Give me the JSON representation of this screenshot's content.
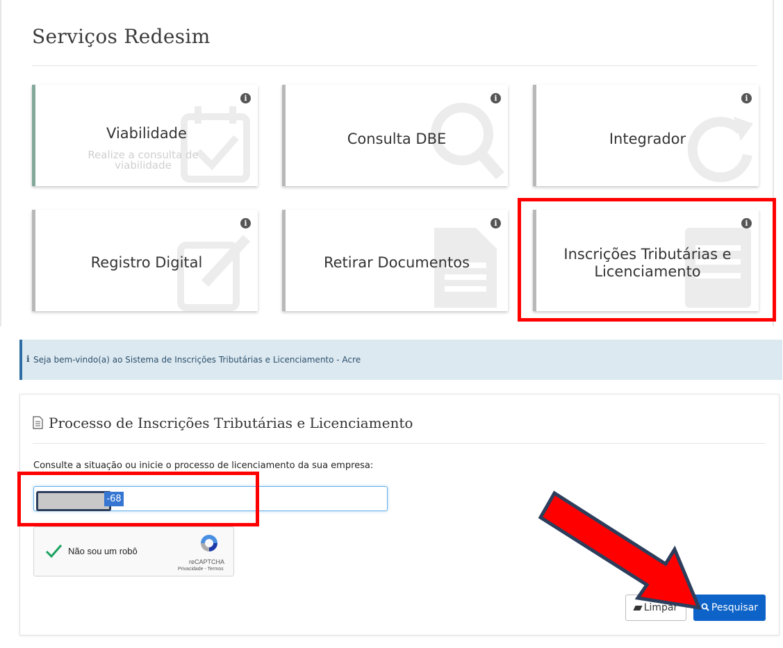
{
  "services": {
    "title": "Serviços Redesim",
    "cards": [
      {
        "label": "Viabilidade",
        "subtitle": "Realize a consulta de viabilidade",
        "icon": "calendar-check-icon"
      },
      {
        "label": "Consulta DBE",
        "icon": "search-icon"
      },
      {
        "label": "Integrador",
        "icon": "refresh-icon"
      },
      {
        "label": "Registro Digital",
        "icon": "edit-icon"
      },
      {
        "label": "Retirar Documentos",
        "icon": "document-icon"
      },
      {
        "label": "Inscrições Tributárias e Licenciamento",
        "icon": "list-icon"
      }
    ],
    "info_icon": "i"
  },
  "alert": {
    "icon": "i",
    "text": "Seja bem-vindo(a) ao Sistema de Inscrições Tributárias e Licenciamento - Acre"
  },
  "process": {
    "title": "Processo de Inscrições Tributárias e Licenciamento",
    "label": "Consulte a situação ou inicie o processo de licenciamento da sua empresa:",
    "input_value_visible": "-68",
    "recaptcha": {
      "text": "Não sou um robô",
      "brand": "reCAPTCHA",
      "links": "Privacidade - Termos"
    },
    "buttons": {
      "clear": "Limpar",
      "search": "Pesquisar"
    }
  },
  "colors": {
    "highlight": "#ff0000",
    "arrow_fill": "#ff0000",
    "arrow_stroke": "#2c3e5c",
    "primary_button": "#0d63c8",
    "alert_bg": "#dce9f1"
  }
}
